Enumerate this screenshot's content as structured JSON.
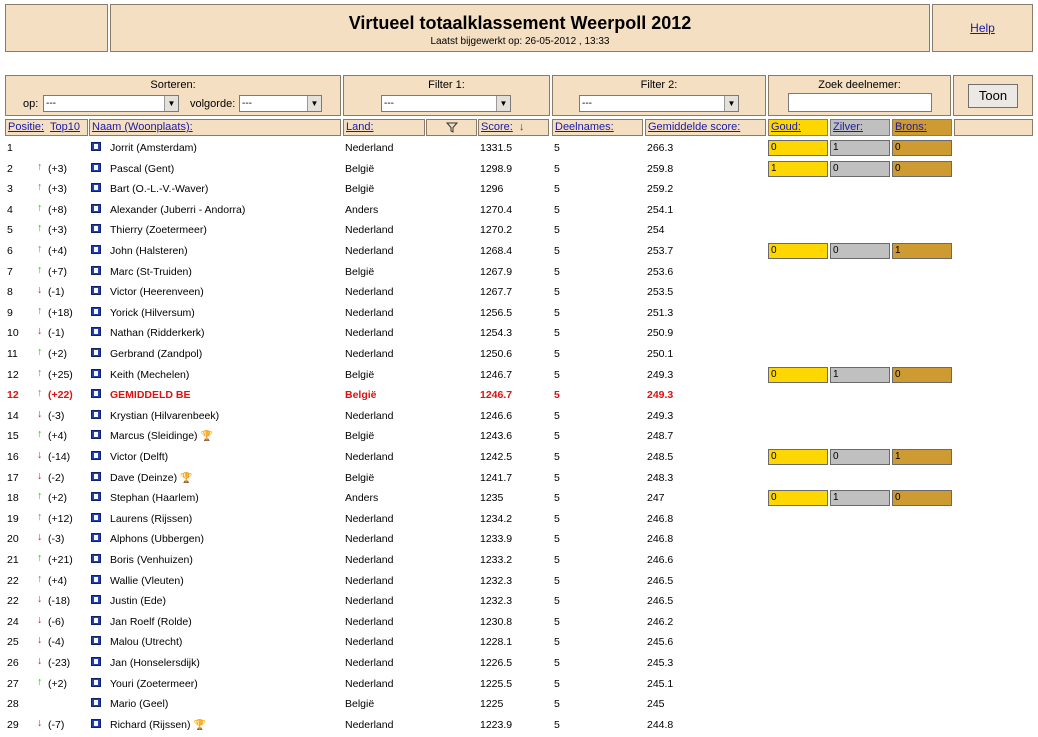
{
  "page": {
    "title": "Virtueel totaalklassement Weerpoll 2012",
    "updated": "Laatst bijgewerkt op: 26-05-2012 , 13:33",
    "help": "Help"
  },
  "controls": {
    "sort_label": "Sorteren:",
    "op_label": "op:",
    "op_value": "---",
    "order_label": "volgorde:",
    "order_value": "---",
    "filter1_label": "Filter 1:",
    "filter1_value": "---",
    "filter2_label": "Filter 2:",
    "filter2_value": "---",
    "search_label": "Zoek deelnemer:",
    "search_value": "",
    "show_button": "Toon"
  },
  "headers": {
    "position": "Positie:",
    "top10": "Top10",
    "name": "Naam (Woonplaats):",
    "country": "Land:",
    "score": "Score:",
    "entries": "Deelnames:",
    "avg": "Gemiddelde score:",
    "gold": "Goud:",
    "silver": "Zilver:",
    "bronze": "Brons:"
  },
  "rows": [
    {
      "pos": "1",
      "dir": "",
      "change": "",
      "name": "Jorrit (Amsterdam)",
      "trophy": false,
      "country": "Nederland",
      "score": "1331.5",
      "entries": "5",
      "avg": "266.3",
      "medals": [
        "0",
        "1",
        "0"
      ]
    },
    {
      "pos": "2",
      "dir": "up",
      "change": "(+3)",
      "name": "Pascal (Gent)",
      "trophy": false,
      "country": "België",
      "score": "1298.9",
      "entries": "5",
      "avg": "259.8",
      "medals": [
        "1",
        "0",
        "0"
      ]
    },
    {
      "pos": "3",
      "dir": "up",
      "change": "(+3)",
      "name": "Bart (O.-L.-V.-Waver)",
      "trophy": false,
      "country": "België",
      "score": "1296",
      "entries": "5",
      "avg": "259.2",
      "medals": null
    },
    {
      "pos": "4",
      "dir": "up",
      "change": "(+8)",
      "name": "Alexander (Juberri - Andorra)",
      "trophy": false,
      "country": "Anders",
      "score": "1270.4",
      "entries": "5",
      "avg": "254.1",
      "medals": null
    },
    {
      "pos": "5",
      "dir": "up",
      "change": "(+3)",
      "name": "Thierry (Zoetermeer)",
      "trophy": false,
      "country": "Nederland",
      "score": "1270.2",
      "entries": "5",
      "avg": "254",
      "medals": null
    },
    {
      "pos": "6",
      "dir": "up",
      "change": "(+4)",
      "name": "John (Halsteren)",
      "trophy": false,
      "country": "Nederland",
      "score": "1268.4",
      "entries": "5",
      "avg": "253.7",
      "medals": [
        "0",
        "0",
        "1"
      ]
    },
    {
      "pos": "7",
      "dir": "up",
      "change": "(+7)",
      "name": "Marc (St-Truiden)",
      "trophy": false,
      "country": "België",
      "score": "1267.9",
      "entries": "5",
      "avg": "253.6",
      "medals": null
    },
    {
      "pos": "8",
      "dir": "down",
      "change": "(-1)",
      "name": "Victor (Heerenveen)",
      "trophy": false,
      "country": "Nederland",
      "score": "1267.7",
      "entries": "5",
      "avg": "253.5",
      "medals": null
    },
    {
      "pos": "9",
      "dir": "up",
      "change": "(+18)",
      "name": "Yorick (Hilversum)",
      "trophy": false,
      "country": "Nederland",
      "score": "1256.5",
      "entries": "5",
      "avg": "251.3",
      "medals": null
    },
    {
      "pos": "10",
      "dir": "down",
      "change": "(-1)",
      "name": "Nathan (Ridderkerk)",
      "trophy": false,
      "country": "Nederland",
      "score": "1254.3",
      "entries": "5",
      "avg": "250.9",
      "medals": null
    },
    {
      "pos": "11",
      "dir": "up",
      "change": "(+2)",
      "name": "Gerbrand (Zandpol)",
      "trophy": false,
      "country": "Nederland",
      "score": "1250.6",
      "entries": "5",
      "avg": "250.1",
      "medals": null
    },
    {
      "pos": "12",
      "dir": "up",
      "change": "(+25)",
      "name": "Keith (Mechelen)",
      "trophy": false,
      "country": "België",
      "score": "1246.7",
      "entries": "5",
      "avg": "249.3",
      "medals": [
        "0",
        "1",
        "0"
      ]
    },
    {
      "pos": "12",
      "dir": "up",
      "change": "(+22)",
      "name": "GEMIDDELD BE",
      "trophy": false,
      "country": "België",
      "score": "1246.7",
      "entries": "5",
      "avg": "249.3",
      "medals": null,
      "highlight": true
    },
    {
      "pos": "14",
      "dir": "down",
      "change": "(-3)",
      "name": "Krystian (Hilvarenbeek)",
      "trophy": false,
      "country": "Nederland",
      "score": "1246.6",
      "entries": "5",
      "avg": "249.3",
      "medals": null
    },
    {
      "pos": "15",
      "dir": "up",
      "change": "(+4)",
      "name": "Marcus (Sleidinge)",
      "trophy": true,
      "country": "België",
      "score": "1243.6",
      "entries": "5",
      "avg": "248.7",
      "medals": null
    },
    {
      "pos": "16",
      "dir": "down",
      "change": "(-14)",
      "name": "Victor (Delft)",
      "trophy": false,
      "country": "Nederland",
      "score": "1242.5",
      "entries": "5",
      "avg": "248.5",
      "medals": [
        "0",
        "0",
        "1"
      ]
    },
    {
      "pos": "17",
      "dir": "down",
      "change": "(-2)",
      "name": "Dave (Deinze)",
      "trophy": true,
      "country": "België",
      "score": "1241.7",
      "entries": "5",
      "avg": "248.3",
      "medals": null
    },
    {
      "pos": "18",
      "dir": "up",
      "change": "(+2)",
      "name": "Stephan (Haarlem)",
      "trophy": false,
      "country": "Anders",
      "score": "1235",
      "entries": "5",
      "avg": "247",
      "medals": [
        "0",
        "1",
        "0"
      ]
    },
    {
      "pos": "19",
      "dir": "up",
      "change": "(+12)",
      "name": "Laurens (Rijssen)",
      "trophy": false,
      "country": "Nederland",
      "score": "1234.2",
      "entries": "5",
      "avg": "246.8",
      "medals": null
    },
    {
      "pos": "20",
      "dir": "down",
      "change": "(-3)",
      "name": "Alphons (Ubbergen)",
      "trophy": false,
      "country": "Nederland",
      "score": "1233.9",
      "entries": "5",
      "avg": "246.8",
      "medals": null
    },
    {
      "pos": "21",
      "dir": "up",
      "change": "(+21)",
      "name": "Boris (Venhuizen)",
      "trophy": false,
      "country": "Nederland",
      "score": "1233.2",
      "entries": "5",
      "avg": "246.6",
      "medals": null
    },
    {
      "pos": "22",
      "dir": "up",
      "change": "(+4)",
      "name": "Wallie (Vleuten)",
      "trophy": false,
      "country": "Nederland",
      "score": "1232.3",
      "entries": "5",
      "avg": "246.5",
      "medals": null
    },
    {
      "pos": "22",
      "dir": "down",
      "change": "(-18)",
      "name": "Justin (Ede)",
      "trophy": false,
      "country": "Nederland",
      "score": "1232.3",
      "entries": "5",
      "avg": "246.5",
      "medals": null
    },
    {
      "pos": "24",
      "dir": "down",
      "change": "(-6)",
      "name": "Jan Roelf (Rolde)",
      "trophy": false,
      "country": "Nederland",
      "score": "1230.8",
      "entries": "5",
      "avg": "246.2",
      "medals": null
    },
    {
      "pos": "25",
      "dir": "down",
      "change": "(-4)",
      "name": "Malou (Utrecht)",
      "trophy": false,
      "country": "Nederland",
      "score": "1228.1",
      "entries": "5",
      "avg": "245.6",
      "medals": null
    },
    {
      "pos": "26",
      "dir": "down",
      "change": "(-23)",
      "name": "Jan (Honselersdijk)",
      "trophy": false,
      "country": "Nederland",
      "score": "1226.5",
      "entries": "5",
      "avg": "245.3",
      "medals": null
    },
    {
      "pos": "27",
      "dir": "up",
      "change": "(+2)",
      "name": "Youri (Zoetermeer)",
      "trophy": false,
      "country": "Nederland",
      "score": "1225.5",
      "entries": "5",
      "avg": "245.1",
      "medals": null
    },
    {
      "pos": "28",
      "dir": "",
      "change": "",
      "name": "Mario (Geel)",
      "trophy": false,
      "country": "België",
      "score": "1225",
      "entries": "5",
      "avg": "245",
      "medals": null
    },
    {
      "pos": "29",
      "dir": "down",
      "change": "(-7)",
      "name": "Richard (Rijssen)",
      "trophy": true,
      "country": "Nederland",
      "score": "1223.9",
      "entries": "5",
      "avg": "244.8",
      "medals": null
    }
  ],
  "colors": {
    "panel": "#f5dfc3",
    "gold": "#ffd700",
    "silver": "#c0c0c0",
    "bronze": "#cd9b32",
    "up": "#19b019",
    "down": "#d01010",
    "highlight": "#e01010",
    "link": "#1a1aa6"
  },
  "icons": {
    "sort_desc": "arrow-down-icon",
    "filter": "funnel-icon",
    "flag": "flag-icon",
    "trophy": "trophy-icon"
  }
}
